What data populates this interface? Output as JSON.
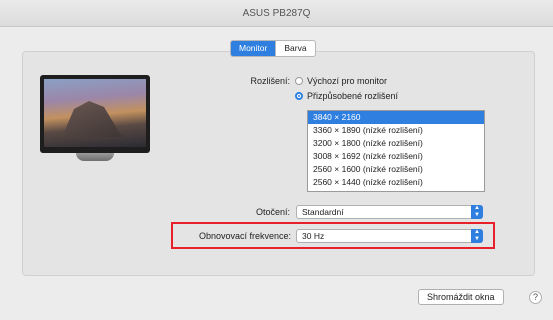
{
  "window": {
    "title": "ASUS PB287Q"
  },
  "tabs": [
    {
      "label": "Monitor",
      "selected": true
    },
    {
      "label": "Barva",
      "selected": false
    }
  ],
  "resolution": {
    "label": "Rozlišení:",
    "options": [
      {
        "label": "Výchozí pro monitor",
        "selected": false
      },
      {
        "label": "Přizpůsobené rozlišení",
        "selected": true
      }
    ],
    "list": [
      "3840 × 2160",
      "3360 × 1890 (nízké rozlišení)",
      "3200 × 1800 (nízké rozlišení)",
      "3008 × 1692 (nízké rozlišení)",
      "2560 × 1600 (nízké rozlišení)",
      "2560 × 1440 (nízké rozlišení)"
    ],
    "selected_index": 0
  },
  "rotation": {
    "label": "Otočení:",
    "value": "Standardní"
  },
  "refresh_rate": {
    "label": "Obnovovací frekvence:",
    "value": "30 Hz"
  },
  "footer": {
    "gather_button": "Shromáždit okna",
    "help": "?"
  },
  "colors": {
    "accent": "#2f7fe0",
    "highlight": "#e8202a"
  },
  "icons": {
    "display": "monitor-icon",
    "popup_arrows": "updown-arrows-icon"
  }
}
